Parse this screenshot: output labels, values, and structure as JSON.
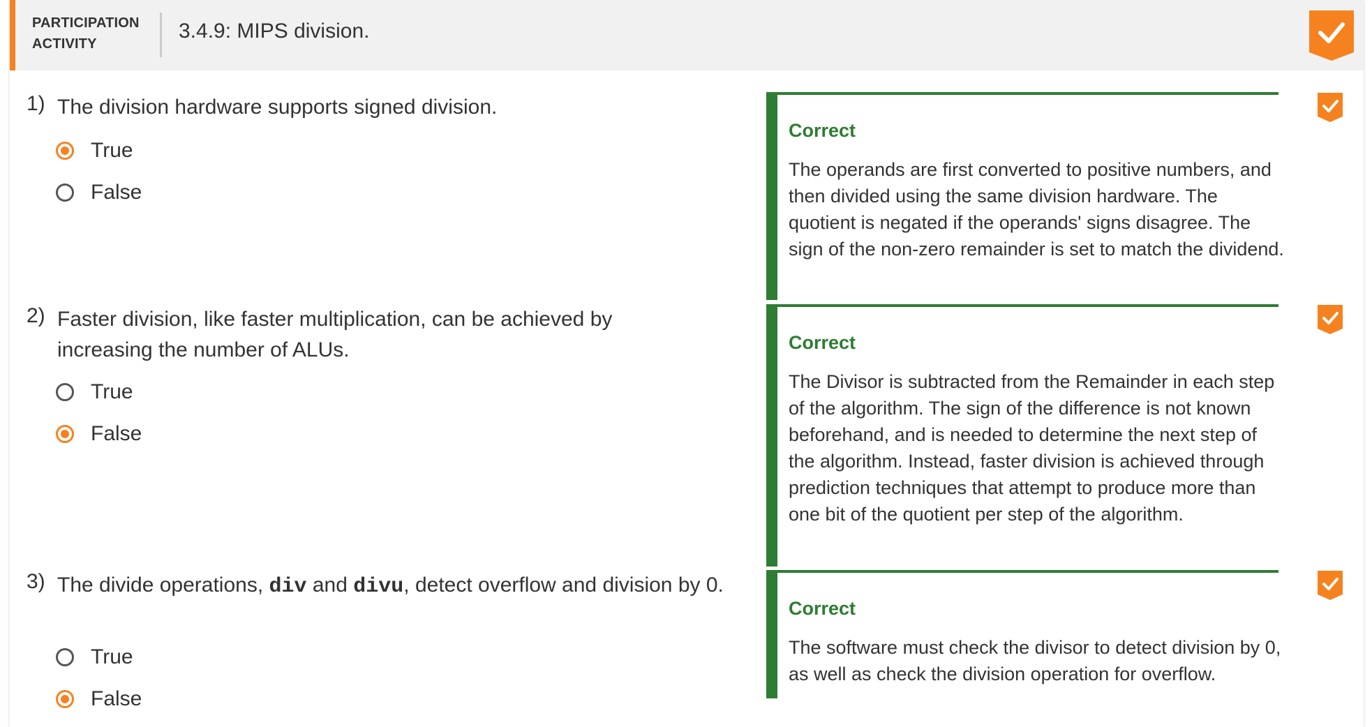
{
  "header": {
    "label_line1": "PARTICIPATION",
    "label_line2": "ACTIVITY",
    "title": "3.4.9: MIPS division.",
    "banner_icon": "checkmark-icon",
    "accent_color": "#f5821f"
  },
  "questions": [
    {
      "number": "1)",
      "text": "The division hardware supports signed division.",
      "options": [
        {
          "label": "True",
          "selected": true
        },
        {
          "label": "False",
          "selected": false
        }
      ],
      "feedback": {
        "status": "Correct",
        "explanation": "The operands are first converted to positive numbers, and then divided using the same division hardware. The quotient is negated if the operands' signs disagree. The sign of the non-zero remainder is set to match the dividend."
      }
    },
    {
      "number": "2)",
      "text": "Faster division, like faster multiplication, can be achieved by increasing the number of ALUs.",
      "options": [
        {
          "label": "True",
          "selected": false
        },
        {
          "label": "False",
          "selected": true
        }
      ],
      "feedback": {
        "status": "Correct",
        "explanation": "The Divisor is subtracted from the Remainder in each step of the algorithm. The sign of the difference is not known beforehand, and is needed to determine the next step of the algorithm. Instead, faster division is achieved through prediction techniques that attempt to produce more than one bit of the quotient per step of the algorithm."
      }
    },
    {
      "number": "3)",
      "text_before": "The divide operations, ",
      "code1": "div",
      "text_mid": " and ",
      "code2": "divu",
      "text_after": ", detect overflow and division by 0.",
      "options": [
        {
          "label": "True",
          "selected": false
        },
        {
          "label": "False",
          "selected": true
        }
      ],
      "feedback": {
        "status": "Correct",
        "explanation": "The software must check the divisor to detect division by 0, as well as check the division operation for overflow."
      }
    }
  ],
  "colors": {
    "correct_green": "#2e7d32",
    "header_bg": "#f1f1f1"
  }
}
